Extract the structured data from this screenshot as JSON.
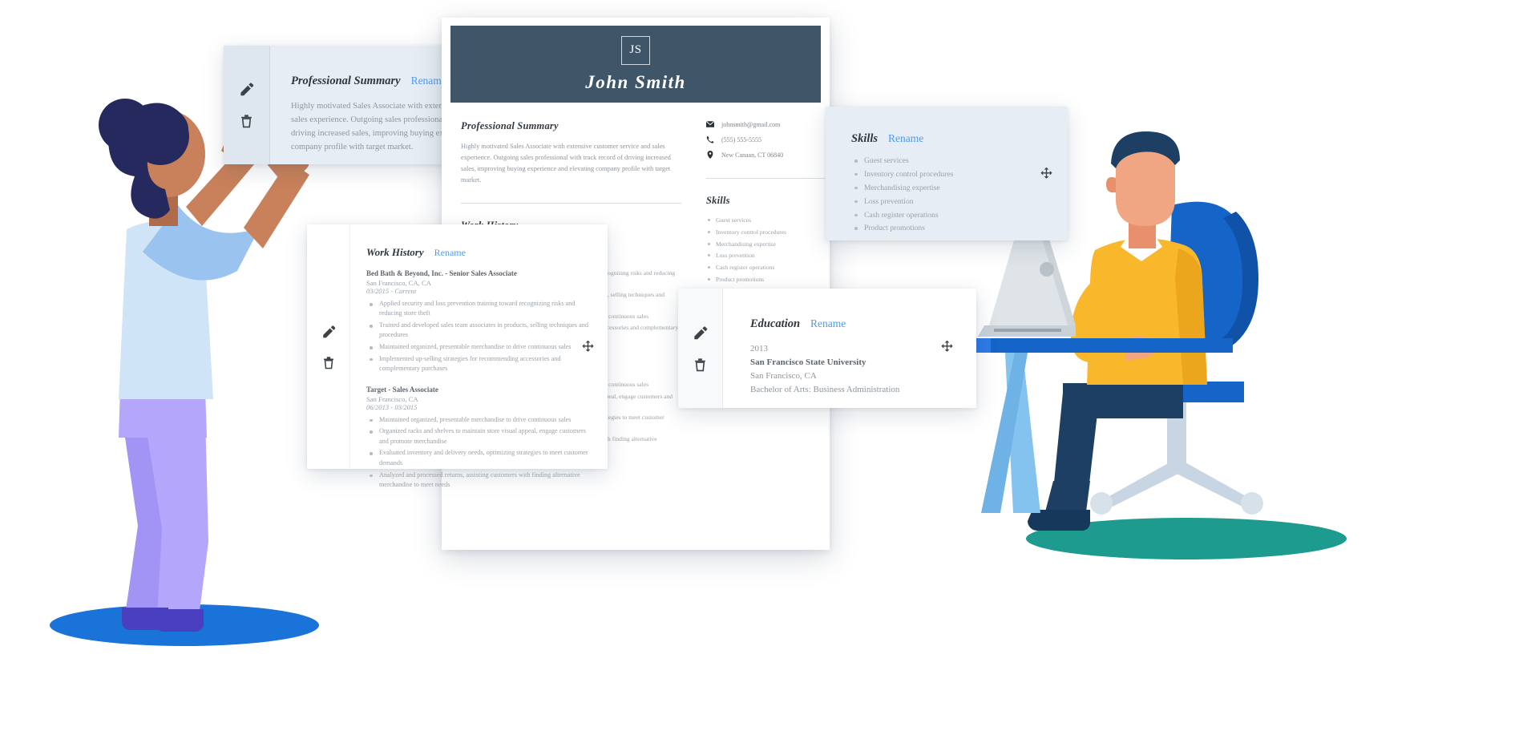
{
  "resume": {
    "monogram": "JS",
    "name": "John Smith",
    "header_color": "#3f5568",
    "accent_color": "#4e9bf0",
    "sections": {
      "summary": {
        "title": "Professional Summary",
        "text": "Highly motivated Sales Associate with extensive customer service and sales experience. Outgoing sales professional with track record of driving increased sales, improving buying experience and elevating company profile with target market."
      },
      "work_history": {
        "title": "Work History",
        "jobs": [
          {
            "title": "Bed Bath & Beyond, Inc. - Senior Sales Associate",
            "location": "San Francisco, CA, CA",
            "dates": "03/2015 - Current",
            "bullets": [
              "Applied security and loss prevention training toward recognizing risks and reducing store theft",
              "Trained and developed sales team associates in products, selling techniques and procedures",
              "Maintained organized, presentable merchandise to drive continuous sales",
              "Implemented up-selling strategies for recommending accessories and complementary purchases"
            ]
          },
          {
            "title": "Target - Sales Associate",
            "location": "San Francisco, CA",
            "dates": "06/2013 - 03/2015",
            "bullets": [
              "Maintained organized, presentable merchandise to drive continuous sales",
              "Organized racks and shelves to maintain store visual appeal, engage customers and promote merchandise",
              "Evaluated inventory and delivery needs, optimizing strategies to meet customer demands",
              "Analyzed and processed returns, assisting customers with finding alternative merchandise to meet needs"
            ]
          }
        ]
      },
      "skills": {
        "title": "Skills",
        "items": [
          "Guest services",
          "Inventory control procedures",
          "Merchandising expertise",
          "Loss prevention",
          "Cash register operations",
          "Product promotions"
        ]
      },
      "education": {
        "title": "Education",
        "year": "2013",
        "school": "San Francisco State University",
        "location": "San Francisco, CA",
        "degree": "Bachelor of Arts: Business Administration"
      },
      "contact": {
        "email": "johnsmith@gmail.com",
        "phone": "(555) 555-5555",
        "address": "New Canaan, CT 06840"
      }
    }
  },
  "cards": {
    "rename_label": "Rename",
    "summary_title": "Professional Summary",
    "work_title": "Work History",
    "skills_title": "Skills",
    "education_title": "Education"
  }
}
